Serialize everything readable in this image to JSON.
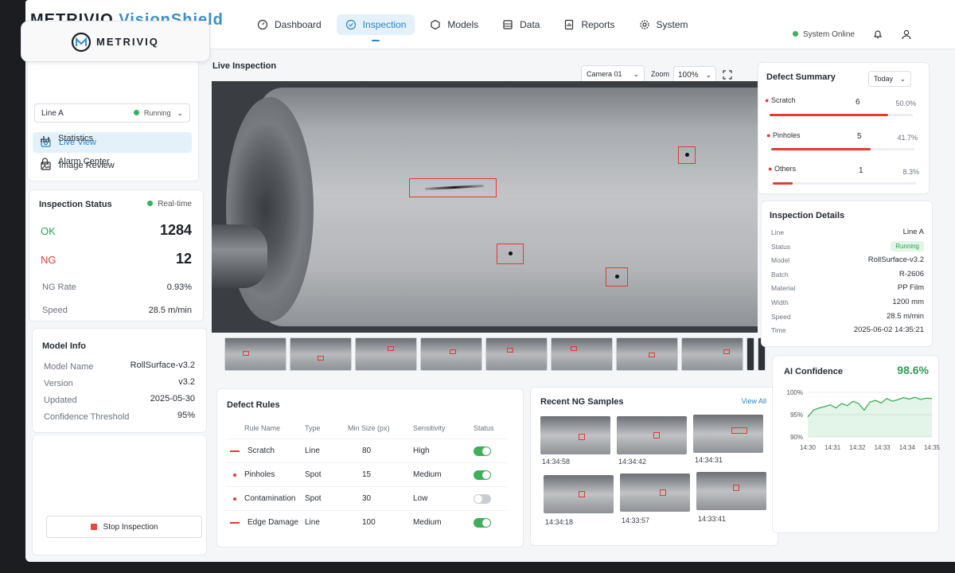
{
  "brand": {
    "name": "METRIVIQ",
    "product": "VisionShield",
    "logo_text": "METRIVIQ"
  },
  "nav": [
    {
      "label": "Dashboard",
      "icon": "dashboard-icon"
    },
    {
      "label": "Inspection",
      "icon": "inspection-icon",
      "active": true
    },
    {
      "label": "Models",
      "icon": "models-icon"
    },
    {
      "label": "Data",
      "icon": "data-icon"
    },
    {
      "label": "Reports",
      "icon": "reports-icon"
    },
    {
      "label": "System",
      "icon": "gear-icon"
    }
  ],
  "header": {
    "status": "System Online"
  },
  "line_select": {
    "line": "Line A",
    "state": "Running"
  },
  "side_menu": [
    {
      "label": "Live View",
      "active": true
    },
    {
      "label": "Image Review"
    },
    {
      "label": "Statistics"
    },
    {
      "label": "Alarm Center"
    }
  ],
  "inspection_status": {
    "title": "Inspection Status",
    "mode": "Real-time",
    "ok_label": "OK",
    "ok_value": "1284",
    "ng_label": "NG",
    "ng_value": "12",
    "ng_rate_label": "NG Rate",
    "ng_rate_value": "0.93%",
    "speed_label": "Speed",
    "speed_value": "28.5 m/min"
  },
  "model_info": {
    "title": "Model Info",
    "rows": [
      {
        "label": "Model Name",
        "value": "RollSurface-v3.2"
      },
      {
        "label": "Version",
        "value": "v3.2"
      },
      {
        "label": "Updated",
        "value": "2025-05-30"
      },
      {
        "label": "Confidence Threshold",
        "value": "95%"
      }
    ]
  },
  "stop_button": "Stop Inspection",
  "live": {
    "title": "Live Inspection",
    "camera": "Camera 01",
    "zoom_label": "Zoom",
    "zoom": "100%"
  },
  "defect_rules": {
    "title": "Defect Rules",
    "headers": [
      "Rule Name",
      "Type",
      "Min Size (px)",
      "Sensitivity",
      "Status"
    ],
    "rows": [
      {
        "name": "Scratch",
        "type": "Line",
        "min": "80",
        "sensitivity": "High",
        "on": true
      },
      {
        "name": "Pinholes",
        "type": "Spot",
        "min": "15",
        "sensitivity": "Medium",
        "on": true
      },
      {
        "name": "Contamination",
        "type": "Spot",
        "min": "30",
        "sensitivity": "Low",
        "on": false
      },
      {
        "name": "Edge Damage",
        "type": "Line",
        "min": "100",
        "sensitivity": "Medium",
        "on": true
      }
    ]
  },
  "recent_ng": {
    "title": "Recent NG Samples",
    "view_all": "View All",
    "times": [
      "14:34:58",
      "14:34:42",
      "14:34:31",
      "14:34:18",
      "14:33:57",
      "14:33:41"
    ]
  },
  "defect_summary": {
    "title": "Defect Summary",
    "period": "Today",
    "items": [
      {
        "label": "Scratch",
        "count": "6",
        "pct": "50.0%",
        "fraction": 0.5
      },
      {
        "label": "Pinholes",
        "count": "5",
        "pct": "41.7%",
        "fraction": 0.417
      },
      {
        "label": "Others",
        "count": "1",
        "pct": "8.3%",
        "fraction": 0.083
      }
    ]
  },
  "inspection_details": {
    "title": "Inspection Details",
    "rows": [
      {
        "label": "Line",
        "value": "Line A"
      },
      {
        "label": "Status",
        "value": "Running"
      },
      {
        "label": "Model",
        "value": "RollSurface-v3.2"
      },
      {
        "label": "Batch",
        "value": "R-2606"
      },
      {
        "label": "Material",
        "value": "PP Film"
      },
      {
        "label": "Width",
        "value": "1200 mm"
      },
      {
        "label": "Speed",
        "value": "28.5 m/min"
      },
      {
        "label": "Time",
        "value": "2025-06-02 14:35:21"
      }
    ]
  },
  "ai_confidence": {
    "title": "AI Confidence",
    "value": "98.6%",
    "y_ticks": [
      "100%",
      "95%",
      "90%"
    ],
    "x_ticks": [
      "14:30",
      "14:31",
      "14:32",
      "14:33",
      "14:34",
      "14:35"
    ],
    "series": [
      94.5,
      96.0,
      96.5,
      96.8,
      97.2,
      96.5,
      97.5,
      97.0,
      98.0,
      97.5,
      96.0,
      97.8,
      98.2,
      97.6,
      98.6,
      98.0,
      98.4,
      98.8,
      98.5,
      98.9,
      98.4,
      98.7,
      98.6
    ]
  },
  "colors": {
    "accent": "#2a86c7",
    "ok": "#33b35a",
    "ng": "#e23b32"
  }
}
